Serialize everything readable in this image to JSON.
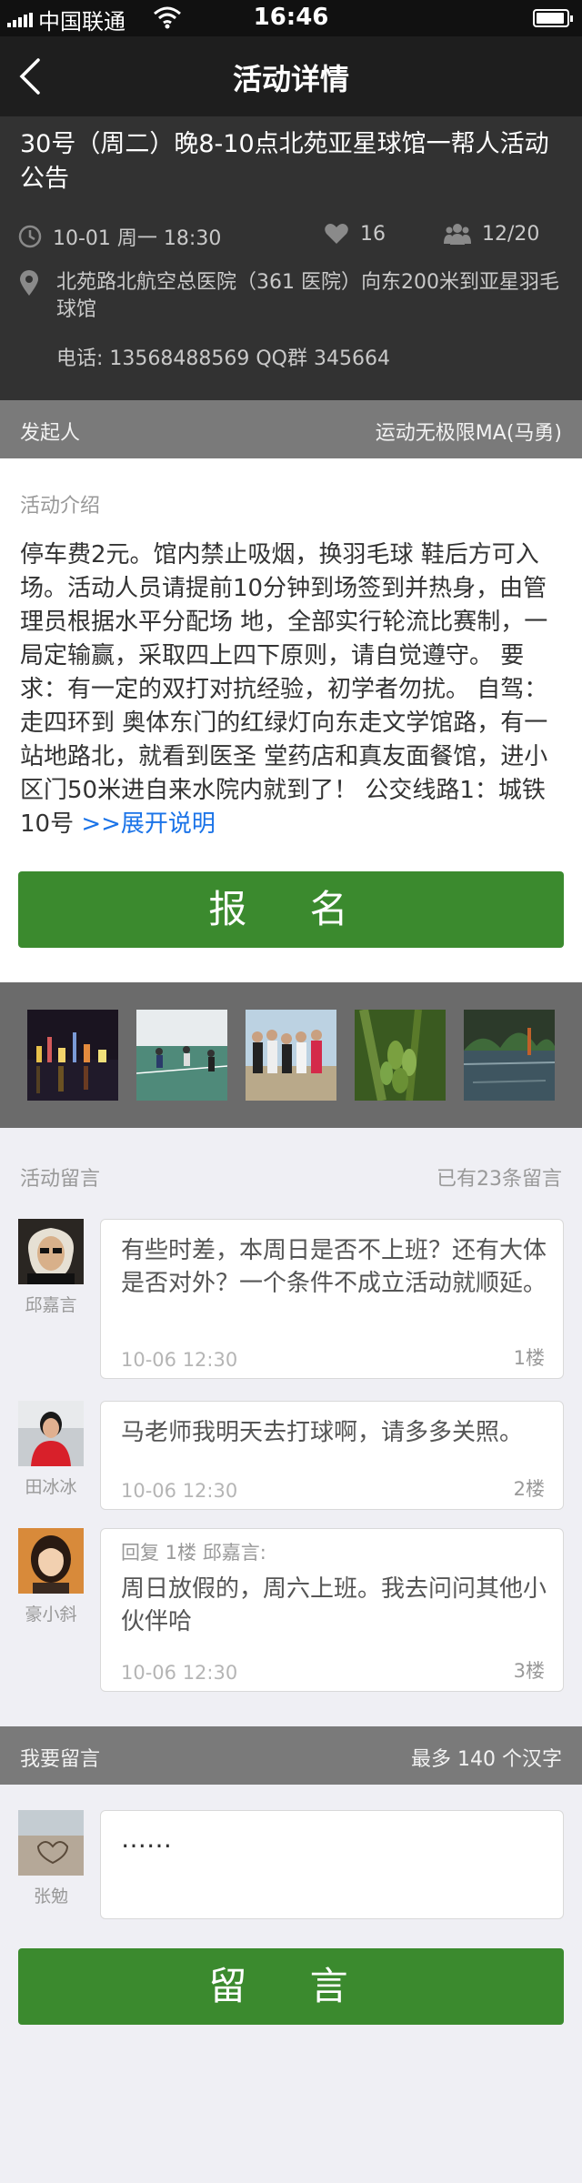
{
  "status_bar": {
    "carrier": "中国联通",
    "time": "16:46"
  },
  "nav": {
    "title": "活动详情",
    "back_icon": "chevron-left-icon"
  },
  "event": {
    "title": "30号（周二）晚8-10点北苑亚星球馆一帮人活动公告",
    "datetime": "10-01 周一 18:30",
    "likes": "16",
    "participants": "12/20",
    "address": "北苑路北航空总医院（361 医院）向东200米到亚星羽毛球馆",
    "contact": "电话: 13568488569 QQ群 345664"
  },
  "organizer": {
    "label": "发起人",
    "name": "运动无极限MA(马勇)"
  },
  "intro": {
    "label": "活动介绍",
    "text": "停车费2元。馆内禁止吸烟，换羽毛球 鞋后方可入场。活动人员请提前10分钟到场签到并热身，由管理员根据水平分配场 地，全部实行轮流比赛制，一局定输赢，采取四上四下原则，请自觉遵守。 要求：有一定的双打对抗经验，初学者勿扰。 自驾： 走四环到 奥体东门的红绿灯向东走文学馆路，有一站地路北，就看到医圣 堂药店和真友面餐馆，进小区门50米进自来水院内就到了！ 公交线路1：城铁10号",
    "expand": ">>展开说明",
    "signup_button": "报 名"
  },
  "comments": {
    "label": "活动留言",
    "count": "已有23条留言",
    "items": [
      {
        "user": "邱嘉言",
        "text": "有些时差，本周日是否不上班？还有大体是否对外？一个条件不成立活动就顺延。",
        "time": "10-06 12:30",
        "floor": "1楼"
      },
      {
        "user": "田冰冰",
        "text": "马老师我明天去打球啊，请多多关照。",
        "time": "10-06 12:30",
        "floor": "2楼"
      },
      {
        "user": "豪小斜",
        "reply_to": "回复 1楼 邱嘉言:",
        "text": "周日放假的，周六上班。我去问问其他小伙伴哈",
        "time": "10-06 12:30",
        "floor": "3楼"
      }
    ]
  },
  "compose": {
    "label": "我要留言",
    "limit": "最多 140 个汉字",
    "user": "张勉",
    "value": "……",
    "submit_button": "留 言"
  },
  "colors": {
    "accent_green": "#3b8a2e",
    "dark_header": "#323232",
    "bar_gray": "#7a7a7a",
    "link_blue": "#1a73e8"
  }
}
